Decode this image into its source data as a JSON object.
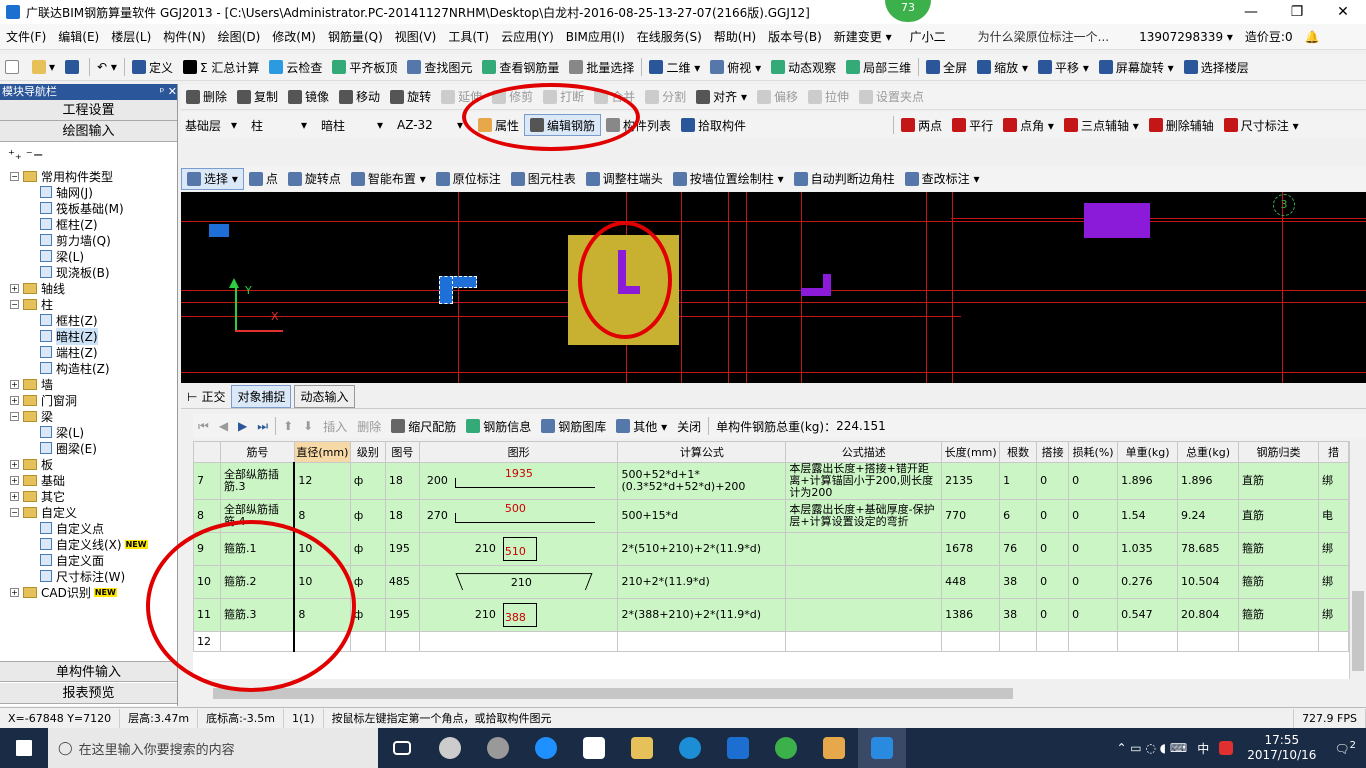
{
  "title": "广联达BIM钢筋算量软件 GGJ2013 - [C:\\Users\\Administrator.PC-20141127NRHM\\Desktop\\白龙村-2016-08-25-13-27-07(2166版).GGJ12]",
  "badge": "73",
  "menu": [
    "文件(F)",
    "编辑(E)",
    "楼层(L)",
    "构件(N)",
    "绘图(D)",
    "修改(M)",
    "钢筋量(Q)",
    "视图(V)",
    "工具(T)",
    "云应用(Y)",
    "BIM应用(I)",
    "在线服务(S)",
    "帮助(H)",
    "版本号(B)",
    "新建变更 ▾",
    "广小二",
    "为什么梁原位标注一个...",
    "13907298339 ▾",
    "造价豆:0",
    "🔔"
  ],
  "toolbar1": [
    "定义",
    "Σ 汇总计算",
    "云检查",
    "平齐板顶",
    "查找图元",
    "查看钢筋量",
    "批量选择",
    "二维 ▾",
    "俯视 ▾",
    "动态观察",
    "局部三维",
    "全屏",
    "缩放 ▾",
    "平移 ▾",
    "屏幕旋转 ▾",
    "选择楼层"
  ],
  "toolbar2": [
    "删除",
    "复制",
    "镜像",
    "移动",
    "旋转",
    "延伸",
    "修剪",
    "打断",
    "合并",
    "分割",
    "对齐 ▾",
    "偏移",
    "拉伸",
    "设置夹点"
  ],
  "toolbar3": {
    "floor": "基础层",
    "type": "柱",
    "sub": "暗柱",
    "name": "AZ-32",
    "buttons": [
      "属性",
      "编辑钢筋",
      "构件列表",
      "拾取构件"
    ],
    "right": [
      "两点",
      "平行",
      "点角 ▾",
      "三点辅轴 ▾",
      "删除辅轴",
      "尺寸标注 ▾"
    ]
  },
  "toolbar4": [
    "选择 ▾",
    "点",
    "旋转点",
    "智能布置 ▾",
    "原位标注",
    "图元柱表",
    "调整柱端头",
    "按墙位置绘制柱 ▾",
    "自动判断边角柱",
    "查改标注 ▾"
  ],
  "left": {
    "header": "模块导航栏",
    "pin": "ᵖ ✕",
    "tab1": "工程设置",
    "tab2": "绘图输入",
    "bottom1": "单构件输入",
    "bottom2": "报表预览",
    "tree": [
      {
        "t": "常用构件类型",
        "k": "f",
        "l": 1,
        "x": "−"
      },
      {
        "t": "轴网(J)",
        "k": "l",
        "l": 2
      },
      {
        "t": "筏板基础(M)",
        "k": "l",
        "l": 2
      },
      {
        "t": "框柱(Z)",
        "k": "l",
        "l": 2
      },
      {
        "t": "剪力墙(Q)",
        "k": "l",
        "l": 2
      },
      {
        "t": "梁(L)",
        "k": "l",
        "l": 2
      },
      {
        "t": "现浇板(B)",
        "k": "l",
        "l": 2
      },
      {
        "t": "轴线",
        "k": "f",
        "l": 1,
        "x": "+"
      },
      {
        "t": "柱",
        "k": "f",
        "l": 1,
        "x": "−"
      },
      {
        "t": "框柱(Z)",
        "k": "l",
        "l": 2
      },
      {
        "t": "暗柱(Z)",
        "k": "l",
        "l": 2,
        "sel": true
      },
      {
        "t": "端柱(Z)",
        "k": "l",
        "l": 2
      },
      {
        "t": "构造柱(Z)",
        "k": "l",
        "l": 2
      },
      {
        "t": "墙",
        "k": "f",
        "l": 1,
        "x": "+"
      },
      {
        "t": "门窗洞",
        "k": "f",
        "l": 1,
        "x": "+"
      },
      {
        "t": "梁",
        "k": "f",
        "l": 1,
        "x": "−"
      },
      {
        "t": "梁(L)",
        "k": "l",
        "l": 2
      },
      {
        "t": "圈梁(E)",
        "k": "l",
        "l": 2
      },
      {
        "t": "板",
        "k": "f",
        "l": 1,
        "x": "+"
      },
      {
        "t": "基础",
        "k": "f",
        "l": 1,
        "x": "+"
      },
      {
        "t": "其它",
        "k": "f",
        "l": 1,
        "x": "+"
      },
      {
        "t": "自定义",
        "k": "f",
        "l": 1,
        "x": "−"
      },
      {
        "t": "自定义点",
        "k": "l",
        "l": 2
      },
      {
        "t": "自定义线(X)",
        "k": "l",
        "l": 2,
        "new": "NEW"
      },
      {
        "t": "自定义面",
        "k": "l",
        "l": 2
      },
      {
        "t": "尺寸标注(W)",
        "k": "l",
        "l": 2
      },
      {
        "t": "CAD识别",
        "k": "f",
        "l": 1,
        "x": "+",
        "new": "NEW"
      }
    ]
  },
  "canvas": {
    "axis_y": "Y",
    "axis_x": "X",
    "grid_label": "3"
  },
  "snapbar": [
    "正交",
    "对象捕捉",
    "动态输入"
  ],
  "rebar_toolbar": {
    "buttons": [
      "插入",
      "删除",
      "缩尺配筋",
      "钢筋信息",
      "钢筋图库",
      "其他 ▾",
      "关闭"
    ],
    "total_label": "单构件钢筋总重(kg)：",
    "total": "224.151"
  },
  "table": {
    "headers": [
      "",
      "筋号",
      "直径(mm)",
      "级别",
      "图号",
      "图形",
      "计算公式",
      "公式描述",
      "长度(mm)",
      "根数",
      "搭接",
      "损耗(%)",
      "单重(kg)",
      "总重(kg)",
      "钢筋归类",
      "措"
    ],
    "rows": [
      {
        "no": "7",
        "name": "全部纵筋插筋.3",
        "dia": "12",
        "grade": "ф",
        "fig": "18",
        "shape_l": "200",
        "shape_v": "1935",
        "formula": "500+52*d+1*(0.3*52*d+52*d)+200",
        "desc": "本层露出长度+搭接+错开距离+计算锚固小于200,则长度计为200",
        "len": "2135",
        "count": "1",
        "lap": "0",
        "loss": "0",
        "unit": "1.896",
        "total": "1.896",
        "cat": "直筋",
        "x": "绑"
      },
      {
        "no": "8",
        "name": "全部纵筋插筋.4",
        "dia": "8",
        "grade": "ф",
        "fig": "18",
        "shape_l": "270",
        "shape_v": "500",
        "formula": "500+15*d",
        "desc": "本层露出长度+基础厚度-保护层+计算设置设定的弯折",
        "len": "770",
        "count": "6",
        "lap": "0",
        "loss": "0",
        "unit": "1.54",
        "total": "9.24",
        "cat": "直筋",
        "x": "电"
      },
      {
        "no": "9",
        "name": "箍筋.1",
        "dia": "10",
        "grade": "ф",
        "fig": "195",
        "shape_l": "210",
        "shape_v": "510",
        "formula": "2*(510+210)+2*(11.9*d)",
        "desc": "",
        "len": "1678",
        "count": "76",
        "lap": "0",
        "loss": "0",
        "unit": "1.035",
        "total": "78.685",
        "cat": "箍筋",
        "x": "绑"
      },
      {
        "no": "10",
        "name": "箍筋.2",
        "dia": "10",
        "grade": "ф",
        "fig": "485",
        "shape_l": "",
        "shape_v": "210",
        "formula": "210+2*(11.9*d)",
        "desc": "",
        "len": "448",
        "count": "38",
        "lap": "0",
        "loss": "0",
        "unit": "0.276",
        "total": "10.504",
        "cat": "箍筋",
        "x": "绑"
      },
      {
        "no": "11",
        "name": "箍筋.3",
        "dia": "8",
        "grade": "ф",
        "fig": "195",
        "shape_l": "210",
        "shape_v": "388",
        "formula": "2*(388+210)+2*(11.9*d)",
        "desc": "",
        "len": "1386",
        "count": "38",
        "lap": "0",
        "loss": "0",
        "unit": "0.547",
        "total": "20.804",
        "cat": "箍筋",
        "x": "绑"
      },
      {
        "no": "12",
        "name": "",
        "dia": "",
        "grade": "",
        "fig": "",
        "shape_l": "",
        "shape_v": "",
        "formula": "",
        "desc": "",
        "len": "",
        "count": "",
        "lap": "",
        "loss": "",
        "unit": "",
        "total": "",
        "cat": "",
        "x": ""
      }
    ]
  },
  "status": [
    "X=-67848 Y=7120",
    "层高:3.47m",
    "底标高:-3.5m",
    "1(1)",
    "按鼠标左键指定第一个角点，或拾取构件图元",
    "727.9 FPS"
  ],
  "taskbar": {
    "search": "在这里输入你要搜索的内容",
    "time": "17:55",
    "date": "2017/10/16",
    "ime": "中",
    "notif": "2"
  },
  "colors": {
    "canvas_bg": "#000000",
    "grid": "#c41616",
    "highlight_row": "#ccf5c6",
    "column": "#c8b030",
    "purple": "#8b1bd8",
    "blue": "#1e6fd8",
    "annotation": "#e00000"
  }
}
